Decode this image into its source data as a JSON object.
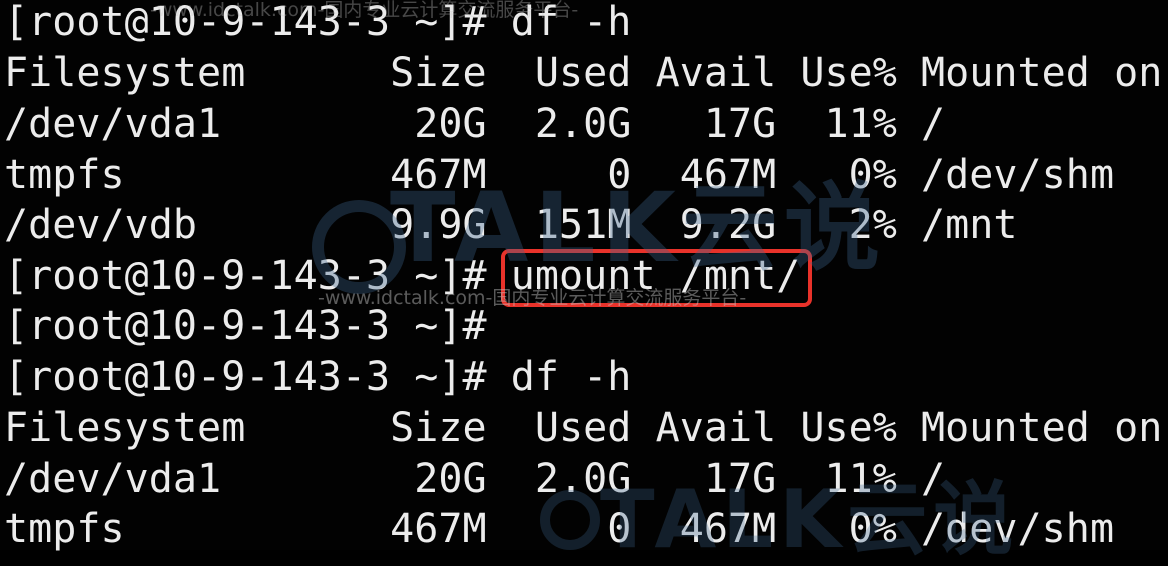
{
  "terminal": {
    "lines": [
      "[root@10-9-143-3 ~]# df -h",
      "Filesystem      Size  Used Avail Use% Mounted on",
      "/dev/vda1        20G  2.0G   17G  11% /",
      "tmpfs           467M     0  467M   0% /dev/shm",
      "/dev/vdb        9.9G  151M  9.2G   2% /mnt",
      "",
      "[root@10-9-143-3 ~]#",
      "[root@10-9-143-3 ~]# df -h",
      "Filesystem      Size  Used Avail Use% Mounted on",
      "/dev/vda1        20G  2.0G   17G  11% /",
      "tmpfs           467M     0  467M   0% /dev/shm"
    ],
    "highlighted_prompt": "[root@10-9-143-3 ~]# ",
    "highlighted_command": "umount /mnt/",
    "highlight_color": "#e8322a",
    "text_color": "#ececec",
    "background": "#020202"
  },
  "watermark": {
    "brand": "TALK云说",
    "tagline": "-www.idctalk.com-国内专业云计算交流服务平台-"
  }
}
